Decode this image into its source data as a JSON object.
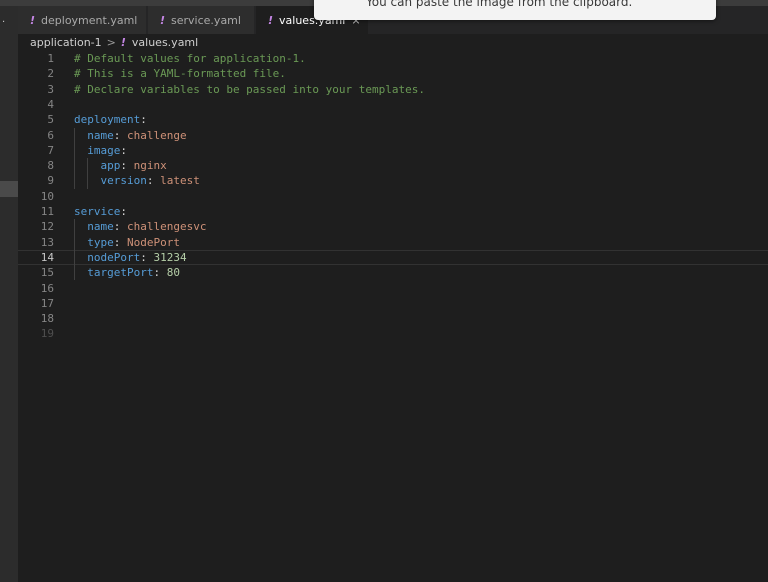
{
  "tabs": [
    {
      "label": "deployment.yaml"
    },
    {
      "label": "service.yaml"
    },
    {
      "label": "values.yaml",
      "close": "×"
    }
  ],
  "tab_icon_glyph": "!",
  "breadcrumb": {
    "folder": "application-1",
    "separator": ">",
    "file": "values.yaml"
  },
  "toast": {
    "text": "You can paste the image from the clipboard."
  },
  "activity_bar": {
    "dot": "·"
  },
  "editor": {
    "current_line": 14,
    "lines": [
      {
        "n": "1",
        "tokens": [
          {
            "t": "# Default values for application-1.",
            "k": "comment"
          }
        ]
      },
      {
        "n": "2",
        "tokens": [
          {
            "t": "# This is a YAML-formatted file.",
            "k": "comment"
          }
        ]
      },
      {
        "n": "3",
        "tokens": [
          {
            "t": "# Declare variables to be passed into your templates.",
            "k": "comment"
          }
        ]
      },
      {
        "n": "4",
        "tokens": []
      },
      {
        "n": "5",
        "tokens": [
          {
            "t": "deployment",
            "k": "key"
          },
          {
            "t": ":",
            "k": "punc"
          }
        ]
      },
      {
        "n": "6",
        "tokens": [
          {
            "t": "  ",
            "k": "punc"
          },
          {
            "t": "name",
            "k": "key"
          },
          {
            "t": ": ",
            "k": "punc"
          },
          {
            "t": "challenge",
            "k": "str"
          }
        ]
      },
      {
        "n": "7",
        "tokens": [
          {
            "t": "  ",
            "k": "punc"
          },
          {
            "t": "image",
            "k": "key"
          },
          {
            "t": ":",
            "k": "punc"
          }
        ]
      },
      {
        "n": "8",
        "tokens": [
          {
            "t": "    ",
            "k": "punc"
          },
          {
            "t": "app",
            "k": "key"
          },
          {
            "t": ": ",
            "k": "punc"
          },
          {
            "t": "nginx",
            "k": "str"
          }
        ]
      },
      {
        "n": "9",
        "tokens": [
          {
            "t": "    ",
            "k": "punc"
          },
          {
            "t": "version",
            "k": "key"
          },
          {
            "t": ": ",
            "k": "punc"
          },
          {
            "t": "latest",
            "k": "str"
          }
        ]
      },
      {
        "n": "10",
        "tokens": []
      },
      {
        "n": "11",
        "tokens": [
          {
            "t": "service",
            "k": "key"
          },
          {
            "t": ":",
            "k": "punc"
          }
        ]
      },
      {
        "n": "12",
        "tokens": [
          {
            "t": "  ",
            "k": "punc"
          },
          {
            "t": "name",
            "k": "key"
          },
          {
            "t": ": ",
            "k": "punc"
          },
          {
            "t": "challengesvc",
            "k": "str"
          }
        ]
      },
      {
        "n": "13",
        "tokens": [
          {
            "t": "  ",
            "k": "punc"
          },
          {
            "t": "type",
            "k": "key"
          },
          {
            "t": ": ",
            "k": "punc"
          },
          {
            "t": "NodePort",
            "k": "str"
          }
        ]
      },
      {
        "n": "14",
        "tokens": [
          {
            "t": "  ",
            "k": "punc"
          },
          {
            "t": "nodePort",
            "k": "key"
          },
          {
            "t": ": ",
            "k": "punc"
          },
          {
            "t": "31234",
            "k": "num"
          }
        ]
      },
      {
        "n": "15",
        "tokens": [
          {
            "t": "  ",
            "k": "punc"
          },
          {
            "t": "targetPort",
            "k": "key"
          },
          {
            "t": ": ",
            "k": "punc"
          },
          {
            "t": "80",
            "k": "num"
          }
        ]
      },
      {
        "n": "16",
        "tokens": []
      },
      {
        "n": "17",
        "tokens": []
      },
      {
        "n": "18",
        "tokens": []
      },
      {
        "n": "19",
        "tokens": [],
        "dim": true
      }
    ]
  },
  "colors": {
    "comment": "#6a9955",
    "key": "#569cd6",
    "string": "#ce9178",
    "number": "#b5cea8",
    "yaml_icon": "#c586e5",
    "background": "#1e1e1e"
  }
}
